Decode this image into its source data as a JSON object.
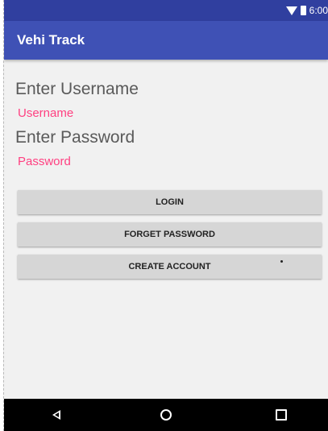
{
  "status_bar": {
    "time": "6:00",
    "icons": [
      "wifi-icon",
      "battery-icon"
    ]
  },
  "app_bar": {
    "title": "Vehi Track",
    "color": "#3f51b5",
    "status_color": "#303f9f"
  },
  "form": {
    "username_heading": "Enter Username",
    "username_placeholder": "Username",
    "password_heading": "Enter Password",
    "password_placeholder": "Password",
    "hint_color": "#ff4081"
  },
  "buttons": {
    "login": "LOGIN",
    "forget_password": "FORGET PASSWORD",
    "create_account": "CREATE ACCOUNT"
  },
  "nav_bar": {
    "icons": [
      "back-icon",
      "home-icon",
      "recents-icon"
    ]
  }
}
